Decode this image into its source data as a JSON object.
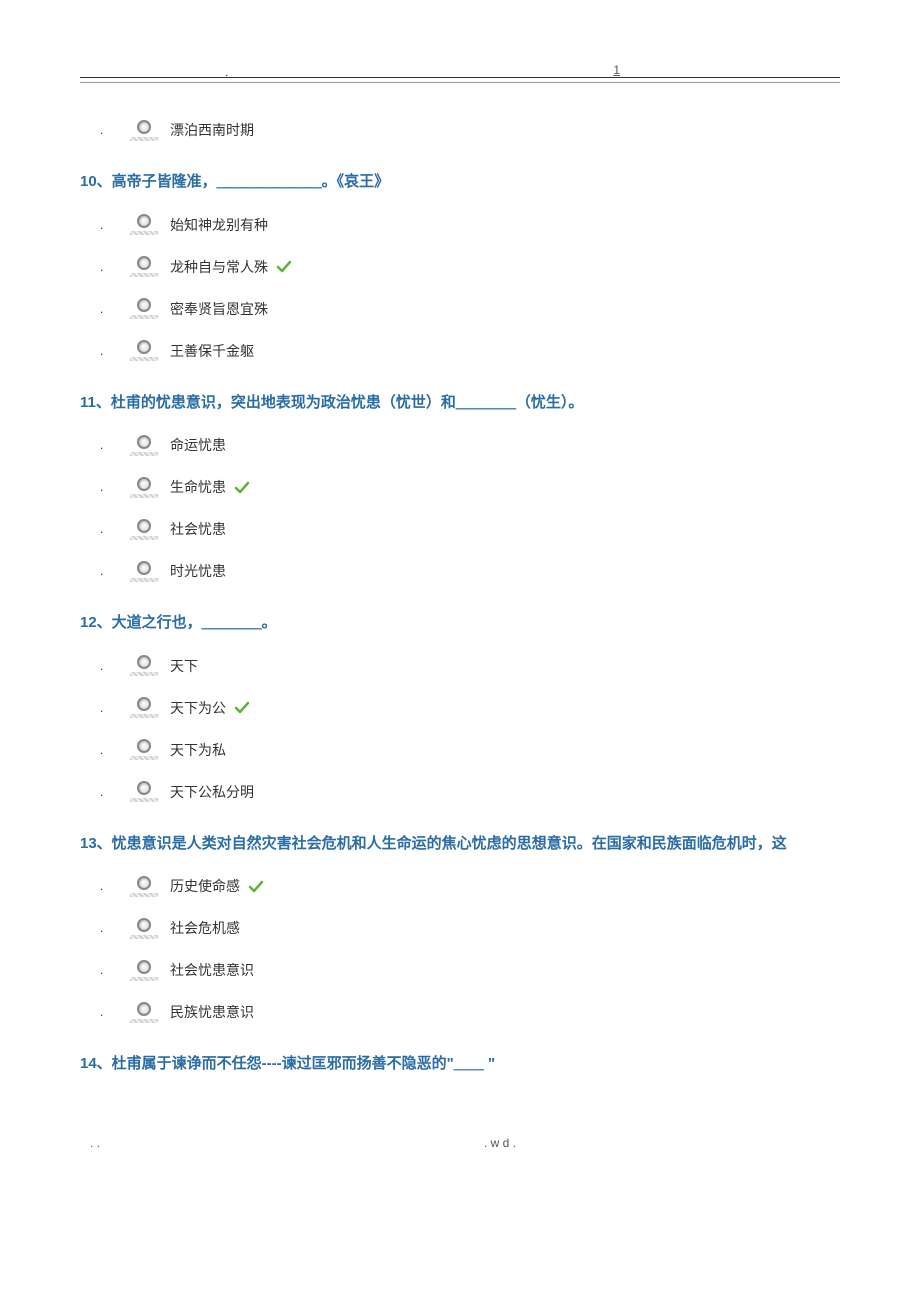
{
  "header": {
    "pageNum": "1",
    "dot": "."
  },
  "questions": [
    {
      "id": "q-prev",
      "title": "",
      "options": [
        {
          "text": "漂泊西南时期",
          "correct": false
        }
      ]
    },
    {
      "id": "q10",
      "title": "10、高帝子皆隆准，＿＿＿＿＿＿＿。《哀王》",
      "options": [
        {
          "text": "始知神龙别有种",
          "correct": false
        },
        {
          "text": "龙种自与常人殊",
          "correct": true
        },
        {
          "text": "密奉贤旨恩宜殊",
          "correct": false
        },
        {
          "text": "王善保千金躯",
          "correct": false
        }
      ]
    },
    {
      "id": "q11",
      "title": "11、杜甫的忧患意识，突出地表现为政治忧患（忧世）和＿＿＿＿（忧生）。",
      "options": [
        {
          "text": "命运忧患",
          "correct": false
        },
        {
          "text": "生命忧患",
          "correct": true
        },
        {
          "text": "社会忧患",
          "correct": false
        },
        {
          "text": "时光忧患",
          "correct": false
        }
      ]
    },
    {
      "id": "q12",
      "title": "12、大道之行也，＿＿＿＿。",
      "options": [
        {
          "text": "天下",
          "correct": false
        },
        {
          "text": "天下为公",
          "correct": true
        },
        {
          "text": "天下为私",
          "correct": false
        },
        {
          "text": "天下公私分明",
          "correct": false
        }
      ]
    },
    {
      "id": "q13",
      "title": "13、忧患意识是人类对自然灾害社会危机和人生命运的焦心忧虑的思想意识。在国家和民族面临危机时，这",
      "options": [
        {
          "text": "历史使命感",
          "correct": true
        },
        {
          "text": "社会危机感",
          "correct": false
        },
        {
          "text": "社会忧患意识",
          "correct": false
        },
        {
          "text": "民族忧患意识",
          "correct": false
        }
      ]
    },
    {
      "id": "q14",
      "title": "14、杜甫属于谏诤而不任怨----谏过匡邪而扬善不隐恶的\"＿＿  \"",
      "options": []
    }
  ],
  "footer": {
    "left": ". .",
    "center": ".   w d ."
  }
}
